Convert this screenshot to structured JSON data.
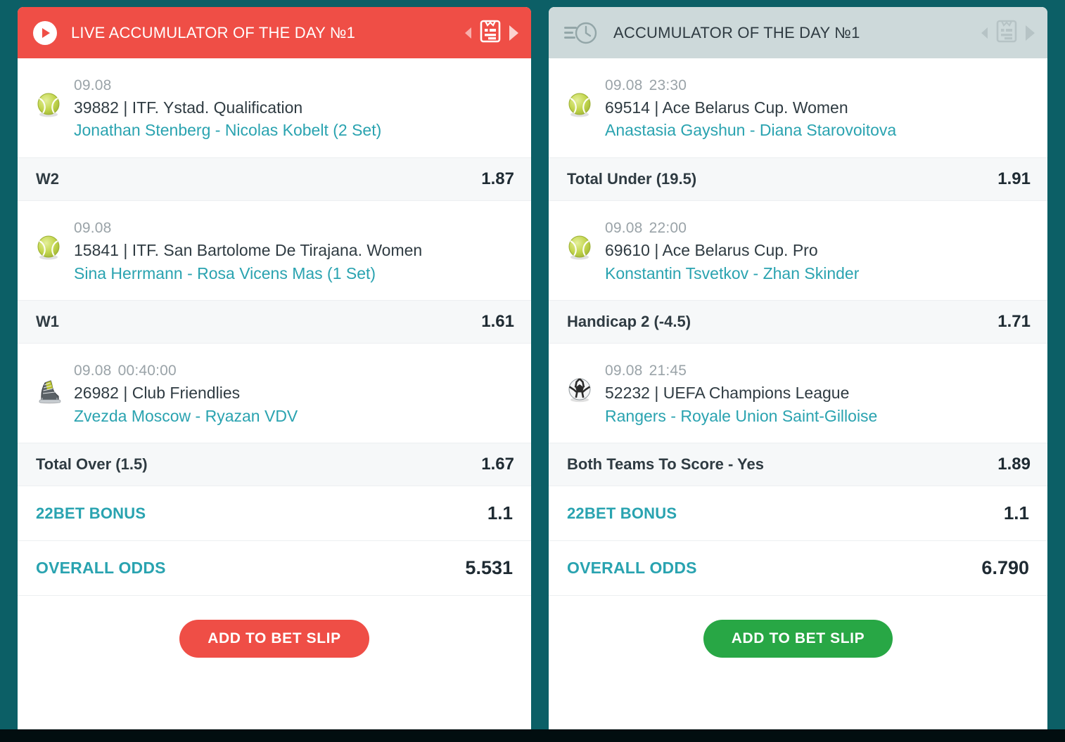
{
  "theme": {
    "page_background": "#0c5f66",
    "bottom_bar": "#020e10",
    "live_header_bg": "#ef4e46",
    "pre_header_bg": "#cdd9da",
    "accent_teal": "#29a3b0",
    "bet_row_bg": "#f6f8f9",
    "cta_red": "#ef4e46",
    "cta_green": "#28a745"
  },
  "panels": [
    {
      "id": "live-accumulator",
      "header": {
        "title": "LIVE ACCUMULATOR OF THE DAY №1",
        "leading_icon": "play-circle-icon",
        "prev_icon": "prev-arrow-icon",
        "slip_icon": "bet-slip-icon",
        "next_icon": "next-arrow-icon"
      },
      "events": [
        {
          "sport_icon": "tennis-ball-icon",
          "date": "09.08",
          "time": "",
          "league": "39882 | ITF. Ystad. Qualification",
          "teams": "Jonathan Stenberg  - Nicolas Kobelt (2 Set)",
          "bet_name": "W2",
          "bet_odd": "1.87"
        },
        {
          "sport_icon": "tennis-ball-icon",
          "date": "09.08",
          "time": "",
          "league": "15841 | ITF. San Bartolome De Tirajana. Women",
          "teams": "Sina Herrmann  - Rosa Vicens Mas (1 Set)",
          "bet_name": "W1",
          "bet_odd": "1.61"
        },
        {
          "sport_icon": "ice-hockey-skate-icon",
          "date": "09.08",
          "time": "00:40:00",
          "league": "26982 | Club Friendlies",
          "teams": "Zvezda Moscow  - Ryazan VDV",
          "bet_name": "Total Over (1.5)",
          "bet_odd": "1.67"
        }
      ],
      "bonus_label": "22BET BONUS",
      "bonus_value": "1.1",
      "overall_label": "OVERALL ODDS",
      "overall_value": "5.531",
      "cta_label": "ADD TO BET SLIP"
    },
    {
      "id": "accumulator",
      "header": {
        "title": "ACCUMULATOR OF THE DAY №1",
        "leading_icon": "clock-icon",
        "prev_icon": "prev-arrow-icon",
        "slip_icon": "bet-slip-icon",
        "next_icon": "next-arrow-icon"
      },
      "events": [
        {
          "sport_icon": "tennis-ball-icon",
          "date": "09.08",
          "time": "23:30",
          "league": "69514 | Ace Belarus Cup. Women",
          "teams": "Anastasia Gayshun  - Diana Starovoitova",
          "bet_name": "Total Under (19.5)",
          "bet_odd": "1.91"
        },
        {
          "sport_icon": "tennis-ball-icon",
          "date": "09.08",
          "time": "22:00",
          "league": "69610 | Ace Belarus Cup. Pro",
          "teams": "Konstantin Tsvetkov  - Zhan Skinder",
          "bet_name": "Handicap 2 (-4.5)",
          "bet_odd": "1.71"
        },
        {
          "sport_icon": "soccer-ball-icon",
          "date": "09.08",
          "time": "21:45",
          "league": "52232 | UEFA Champions League",
          "teams": "Rangers  - Royale Union Saint-Gilloise",
          "bet_name": "Both Teams To Score - Yes",
          "bet_odd": "1.89"
        }
      ],
      "bonus_label": "22BET BONUS",
      "bonus_value": "1.1",
      "overall_label": "OVERALL ODDS",
      "overall_value": "6.790",
      "cta_label": "ADD TO BET SLIP"
    }
  ]
}
